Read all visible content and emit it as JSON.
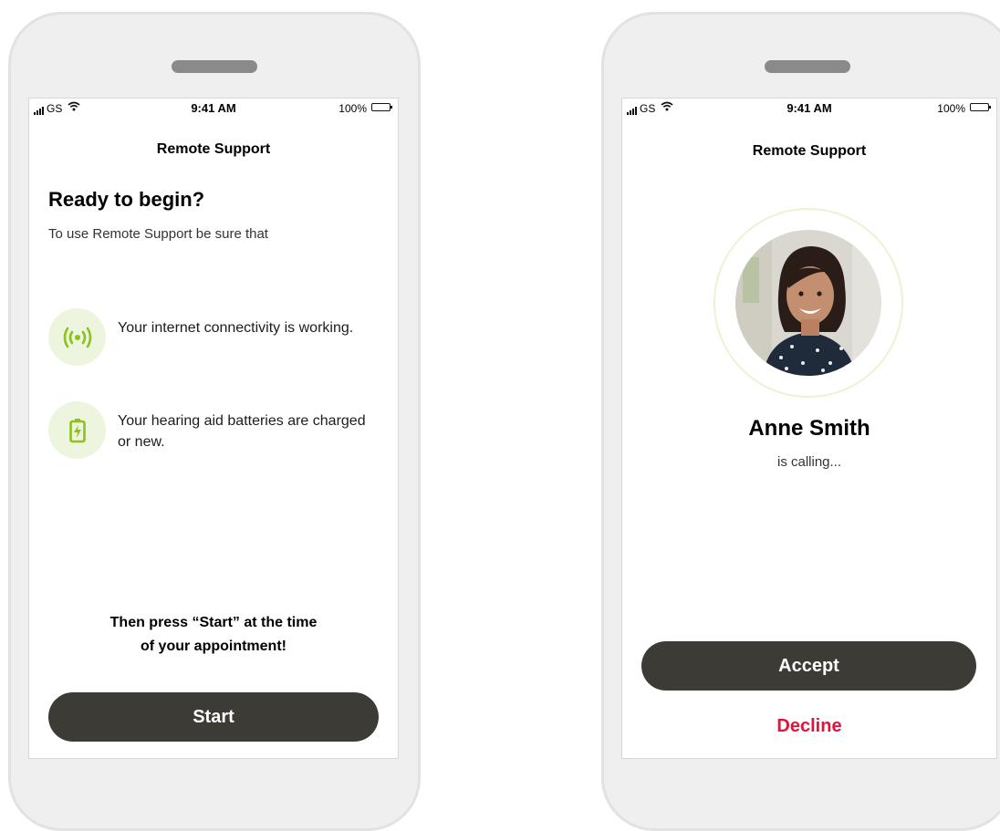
{
  "status_bar": {
    "carrier": "GS",
    "time": "9:41 AM",
    "battery": "100%"
  },
  "left_screen": {
    "nav_title": "Remote Support",
    "heading": "Ready to begin?",
    "subtitle": "To use Remote Support be sure that",
    "checks": [
      {
        "icon": "signal-broadcast-icon",
        "text": "Your internet connectivity is working."
      },
      {
        "icon": "battery-charging-icon",
        "text": "Your hearing aid batteries are charged or new."
      }
    ],
    "instruction_line1": "Then press “Start” at the time",
    "instruction_line2": "of your appointment!",
    "start_label": "Start"
  },
  "right_screen": {
    "nav_title": "Remote Support",
    "caller_name": "Anne Smith",
    "caller_status": "is calling...",
    "accept_label": "Accept",
    "decline_label": "Decline"
  },
  "colors": {
    "button_dark": "#3c3b35",
    "accent_green": "#8cc21a",
    "icon_background": "#eef5df",
    "decline_red": "#e2143c"
  }
}
